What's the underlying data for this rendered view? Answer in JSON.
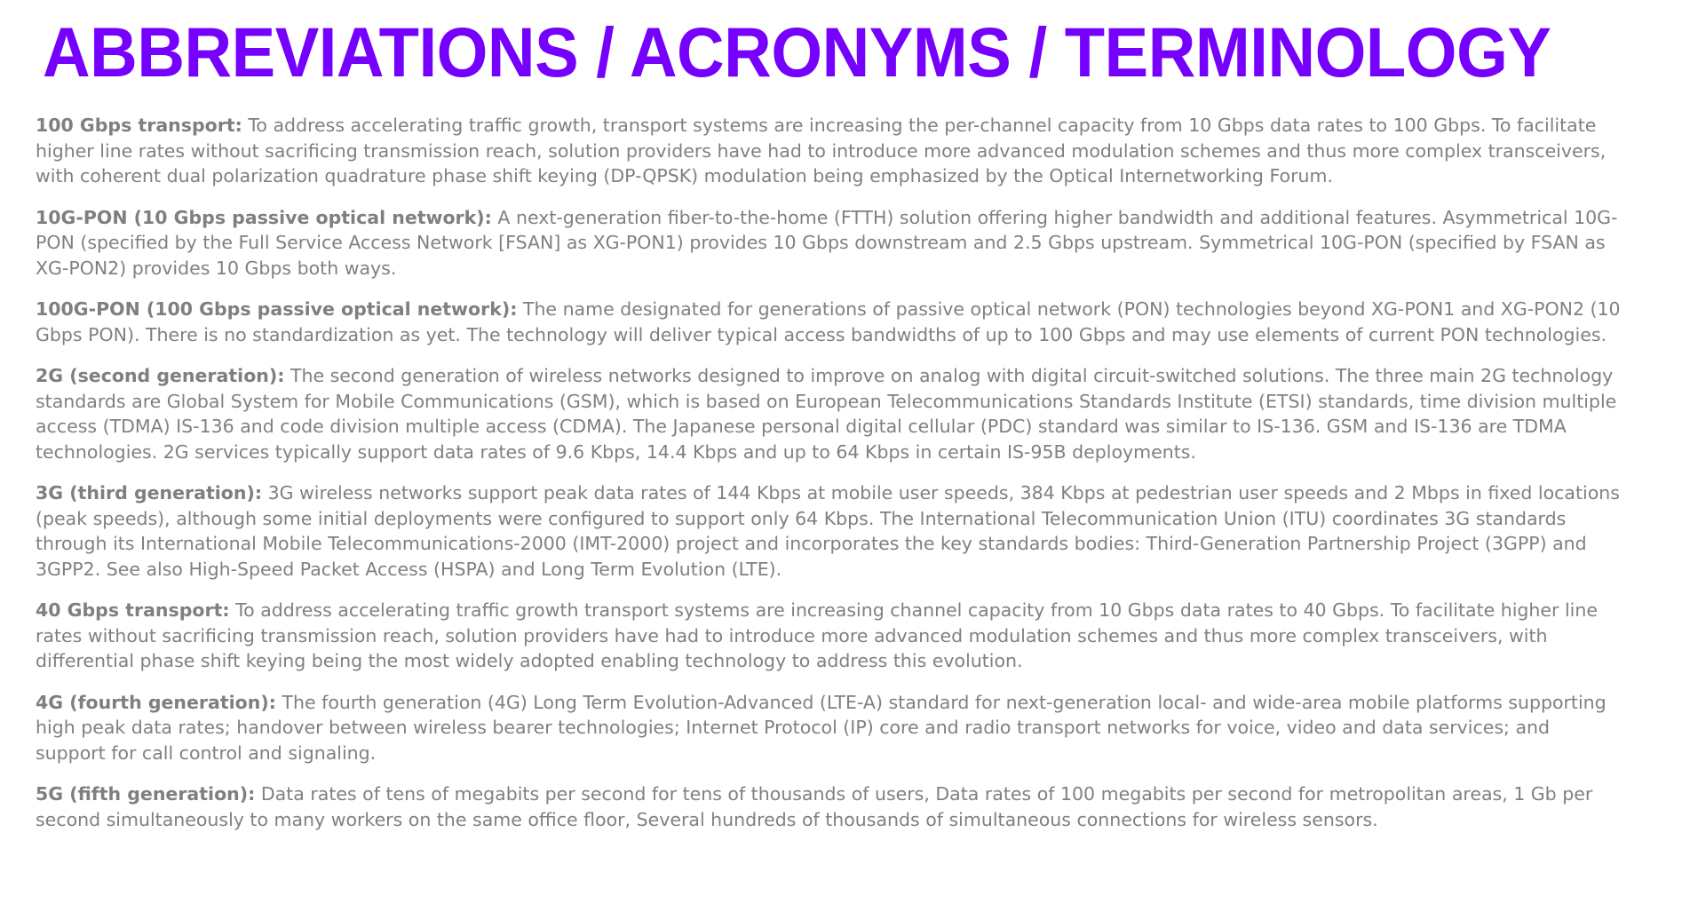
{
  "title": "ABBREVIATIONS / ACRONYMS / TERMINOLOGY",
  "terms": [
    {
      "name": "100 Gbps transport:",
      "definition": "To address accelerating traffic growth, transport systems are increasing the per-channel capacity from 10 Gbps data rates to 100 Gbps. To facilitate higher line rates without sacrificing transmission reach, solution providers have had to introduce more advanced modulation schemes and thus more complex transceivers, with coherent dual polarization quadrature phase shift keying (DP-QPSK) modulation being emphasized by the Optical Internetworking Forum."
    },
    {
      "name": "10G-PON (10 Gbps passive optical network):",
      "definition": "A next-generation fiber-to-the-home (FTTH) solution offering higher bandwidth and additional features. Asymmetrical 10G-PON (specified by the Full Service Access Network [FSAN] as XG-PON1) provides 10 Gbps downstream and 2.5 Gbps upstream. Symmetrical 10G-PON (specified by FSAN as XG-PON2) provides 10 Gbps both ways."
    },
    {
      "name": "100G-PON (100 Gbps passive optical network):",
      "definition": "The name designated for generations of passive optical network (PON) technologies beyond XG-PON1 and XG-PON2 (10 Gbps PON). There is no standardization as yet. The technology will deliver typical access bandwidths of up to 100 Gbps and may use elements of current PON technologies."
    },
    {
      "name": "2G (second generation):",
      "definition": "The second generation of wireless networks designed to improve on analog with digital circuit-switched solutions. The three main 2G technology standards are Global System for Mobile Communications (GSM), which is based on European Telecommunications Standards Institute (ETSI) standards, time division multiple access (TDMA) IS-136 and code division multiple access (CDMA). The Japanese personal digital cellular (PDC) standard was similar to IS-136. GSM and IS-136 are TDMA technologies. 2G services typically support data rates of 9.6 Kbps, 14.4 Kbps and up to 64 Kbps in certain IS-95B deployments."
    },
    {
      "name": "3G (third generation):",
      "definition": "3G wireless networks support peak data rates of 144 Kbps at mobile user speeds, 384 Kbps at pedestrian user speeds and 2 Mbps in fixed locations (peak speeds), although some initial deployments were configured to support only 64 Kbps. The International Telecommunication Union (ITU) coordinates 3G standards through its International Mobile Telecommunications-2000 (IMT-2000) project and incorporates the key standards bodies: Third-Generation Partnership Project (3GPP) and 3GPP2. See also High-Speed Packet Access (HSPA) and Long Term Evolution (LTE)."
    },
    {
      "name": "40 Gbps transport:",
      "definition": "To address accelerating traffic growth transport systems are increasing channel capacity from 10 Gbps data rates to 40 Gbps. To facilitate higher line rates without sacrificing transmission reach, solution providers have had to introduce more advanced modulation schemes and thus more complex transceivers, with differential phase shift keying being the most widely adopted enabling technology to address this evolution."
    },
    {
      "name": "4G (fourth generation):",
      "definition": "The fourth generation (4G) Long Term Evolution-Advanced (LTE-A) standard for next-generation local- and wide-area mobile platforms supporting high peak data rates; handover between wireless bearer technologies; Internet Protocol (IP) core and radio transport networks for voice, video and data services; and support for call control and signaling."
    },
    {
      "name": "5G (fifth generation):",
      "definition": "Data rates of tens of megabits per second for tens of thousands of users, Data rates of 100 megabits per second for metropolitan areas, 1 Gb per second simultaneously to many workers on the same office floor, Several hundreds of thousands of simultaneous connections for wireless sensors."
    }
  ],
  "colors": {
    "title": "#7500fe",
    "body_text": "#808080"
  }
}
